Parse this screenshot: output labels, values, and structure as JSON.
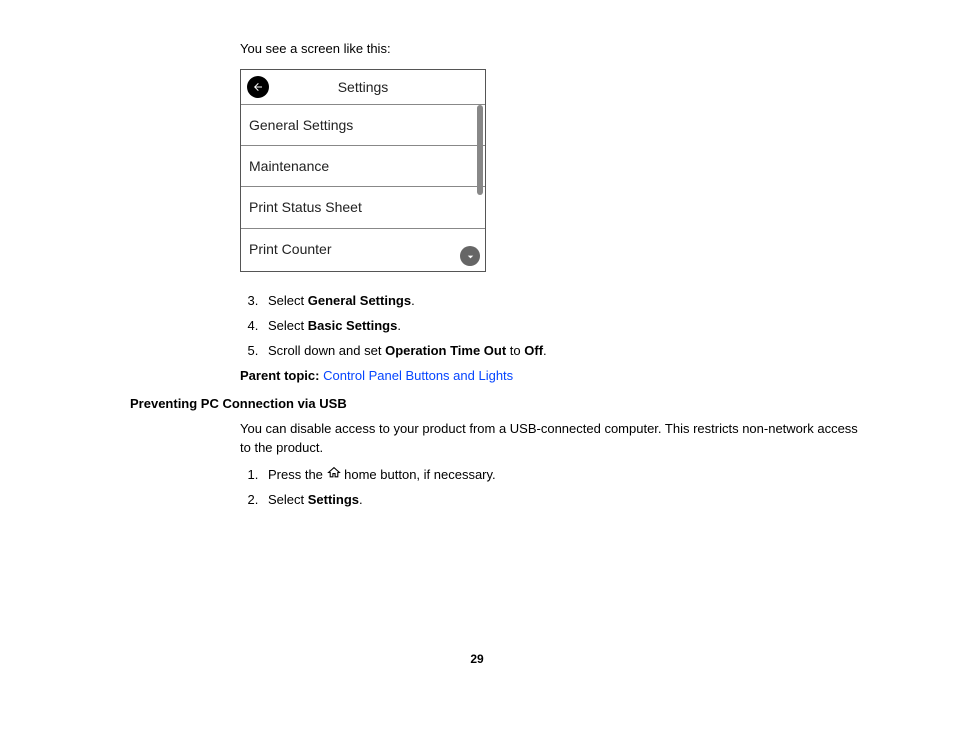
{
  "intro_text": "You see a screen like this:",
  "device": {
    "title": "Settings",
    "rows": [
      "General Settings",
      "Maintenance",
      "Print Status Sheet",
      "Print Counter"
    ]
  },
  "steps_a": {
    "start": 3,
    "items": [
      {
        "prefix": "Select ",
        "bold": "General Settings",
        "suffix": "."
      },
      {
        "prefix": "Select ",
        "bold": "Basic Settings",
        "suffix": "."
      },
      {
        "prefix": "Scroll down and set ",
        "bold": "Operation Time Out",
        "mid": " to ",
        "bold2": "Off",
        "suffix": "."
      }
    ]
  },
  "parent_topic": {
    "label": "Parent topic:",
    "link": "Control Panel Buttons and Lights"
  },
  "section_heading": "Preventing PC Connection via USB",
  "section_para": "You can disable access to your product from a USB-connected computer. This restricts non-network access to the product.",
  "steps_b": {
    "start": 1,
    "items": [
      {
        "prefix": "Press the ",
        "icon": "home",
        "suffix": " home button, if necessary."
      },
      {
        "prefix": "Select ",
        "bold": "Settings",
        "suffix": "."
      }
    ]
  },
  "page_number": "29"
}
